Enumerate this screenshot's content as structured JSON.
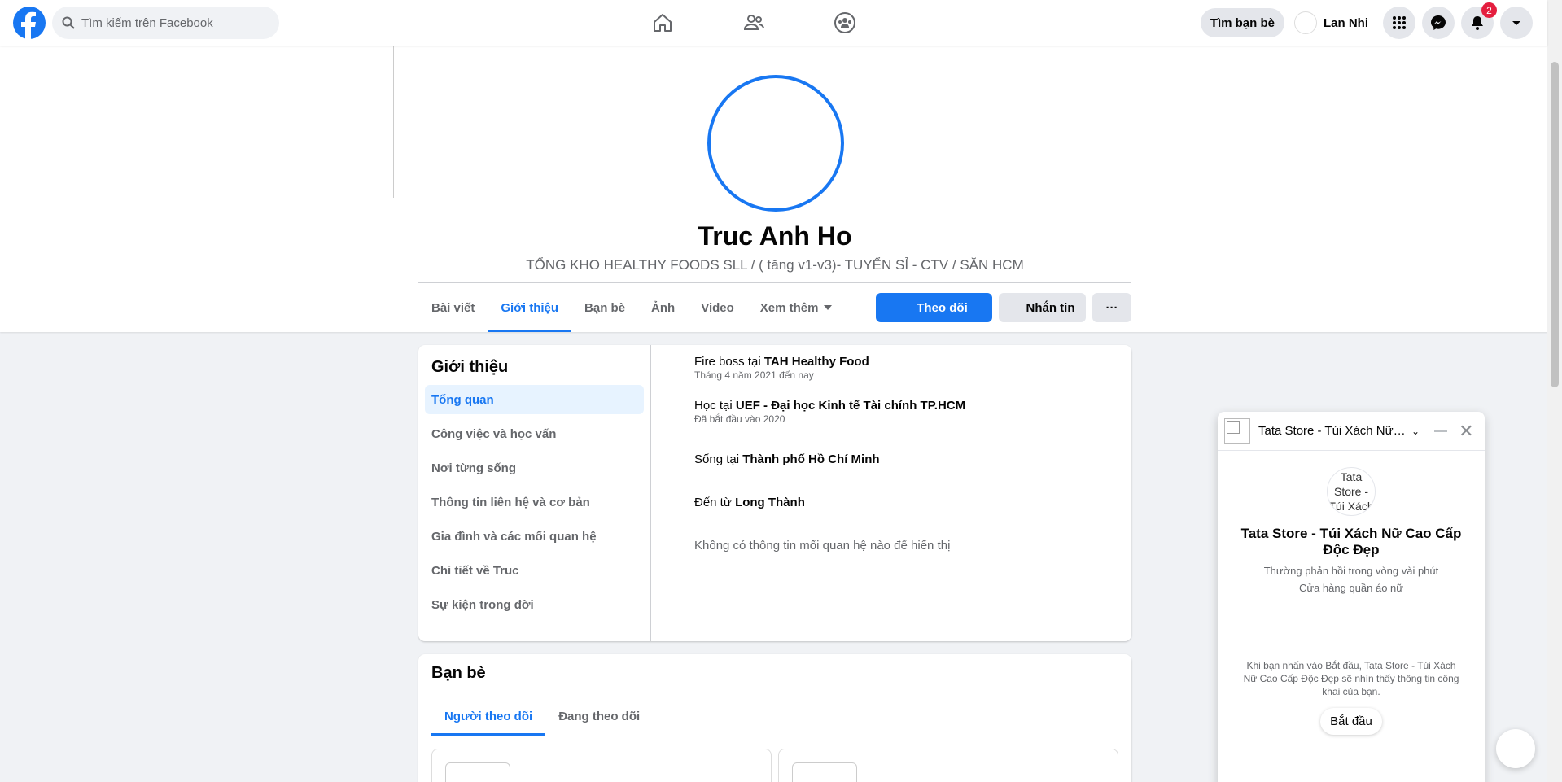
{
  "topbar": {
    "search_placeholder": "Tìm kiếm trên Facebook",
    "find_friends": "Tìm bạn bè",
    "user_name": "Lan Nhi",
    "notification_count": "2"
  },
  "profile": {
    "name": "Truc Anh Ho",
    "bio": "TỔNG KHO HEALTHY FOODS SLL / ( tăng v1-v3)- TUYỂN SỈ - CTV / SĂN HCM",
    "tabs": [
      "Bài viết",
      "Giới thiệu",
      "Bạn bè",
      "Ảnh",
      "Video",
      "Xem thêm"
    ],
    "follow_label": "Theo dõi",
    "message_label": "Nhắn tin",
    "more_label": "···"
  },
  "about": {
    "title": "Giới thiệu",
    "menu": [
      "Tổng quan",
      "Công việc và học vấn",
      "Nơi từng sống",
      "Thông tin liên hệ và cơ bản",
      "Gia đình và các mối quan hệ",
      "Chi tiết về Truc",
      "Sự kiện trong đời"
    ],
    "items": [
      {
        "prefix": "Fire boss tại ",
        "bold": "TAH Healthy Food",
        "sub": "Tháng 4 năm 2021 đến nay"
      },
      {
        "prefix": "Học tại ",
        "bold": "UEF - Đại học Kinh tế Tài chính TP.HCM",
        "sub": "Đã bắt đầu vào 2020"
      },
      {
        "prefix": "Sống tại ",
        "bold": "Thành phố Hồ Chí Minh",
        "sub": ""
      },
      {
        "prefix": "Đến từ ",
        "bold": "Long Thành",
        "sub": ""
      }
    ],
    "no_relationship": "Không có thông tin mối quan hệ nào để hiển thị"
  },
  "friends": {
    "title": "Bạn bè",
    "tabs": [
      "Người theo dõi",
      "Đang theo dõi"
    ]
  },
  "chat": {
    "header_name": "Tata Store - Túi Xách Nữ Cao Cấp Độc Đẹp",
    "pic_alt": "Tata Store - Túi Xách",
    "page_name": "Tata Store - Túi Xách Nữ Cao Cấp Độc Đẹp",
    "response": "Thường phản hồi trong vòng vài phút",
    "category": "Cửa hàng quần áo nữ",
    "notice": "Khi bạn nhấn vào Bắt đầu, Tata Store - Túi Xách Nữ Cao Cấp Độc Đẹp sẽ nhìn thấy thông tin công khai của bạn.",
    "start_label": "Bắt đầu"
  },
  "colors": {
    "accent": "#1877f2",
    "badge": "#e41e3f",
    "background": "#f0f2f5"
  }
}
